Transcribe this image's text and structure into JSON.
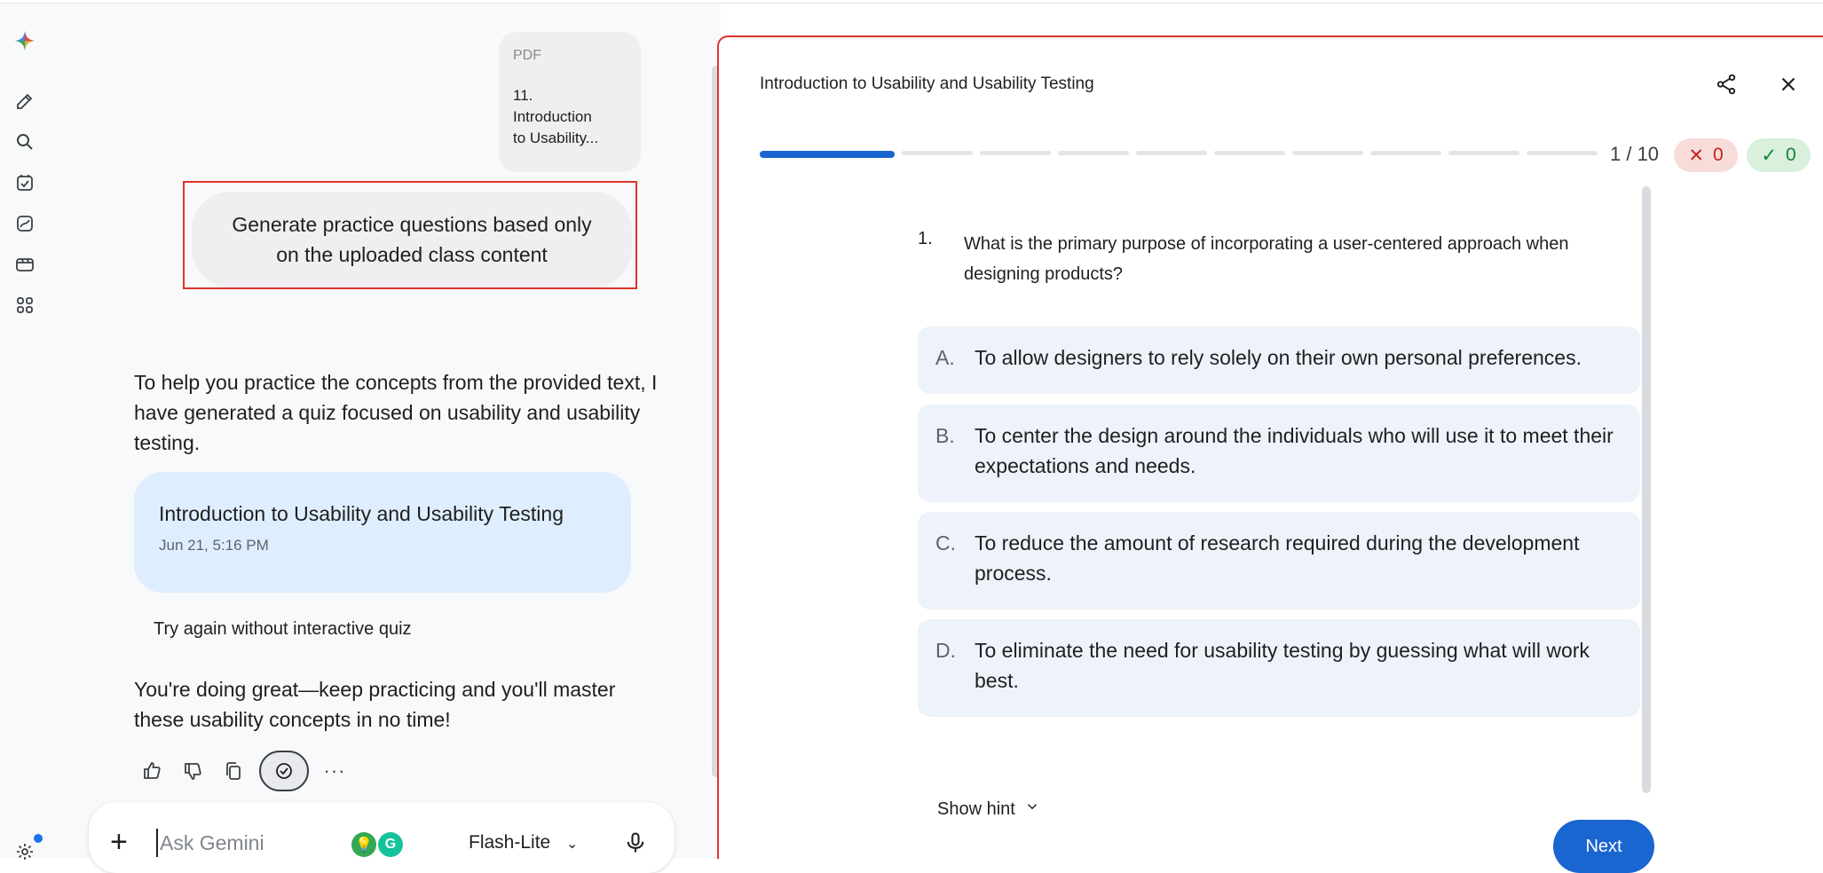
{
  "rail": {
    "icons": [
      "gemini-sparkle-icon",
      "new-chat-icon",
      "search-icon",
      "tasks-icon",
      "gallery-icon",
      "video-icon",
      "apps-icon"
    ]
  },
  "chat": {
    "attachment": {
      "kind": "PDF",
      "name": "11.\nIntroduction\nto Usability..."
    },
    "prompt": "Generate practice questions based only on the uploaded class content",
    "response_intro": "To help you practice the concepts from the provided text, I have generated a quiz focused on usability and usability testing.",
    "quiz_card": {
      "title": "Introduction to Usability and Usability Testing",
      "date": "Jun 21, 5:16 PM"
    },
    "retry_label": "Try again without interactive quiz",
    "closing": "You're doing great—keep practicing and you'll master these usability concepts in no time!",
    "composer": {
      "placeholder": "Ask Gemini",
      "model": "Flash-Lite"
    }
  },
  "quiz": {
    "title": "Introduction to Usability and Usability Testing",
    "progress": {
      "current": 1,
      "total": 10
    },
    "counter": "1 / 10",
    "wrong_count": "0",
    "right_count": "0",
    "question_number": "1.",
    "question": "What is the primary purpose of incorporating a user-centered approach when designing products?",
    "options": [
      {
        "key": "A.",
        "text": "To allow designers to rely solely on their own personal preferences."
      },
      {
        "key": "B.",
        "text": "To center the design around the individuals who will use it to meet their expectations and needs."
      },
      {
        "key": "C.",
        "text": "To reduce the amount of research required during the development process."
      },
      {
        "key": "D.",
        "text": "To eliminate the need for usability testing by guessing what will work best."
      }
    ],
    "hint_label": "Show hint",
    "next_label": "Next"
  },
  "colors": {
    "accent": "#1a66d0",
    "highlight_border": "#e0342b",
    "option_bg": "#eef2fa",
    "quiz_card_bg": "#deeefe"
  }
}
